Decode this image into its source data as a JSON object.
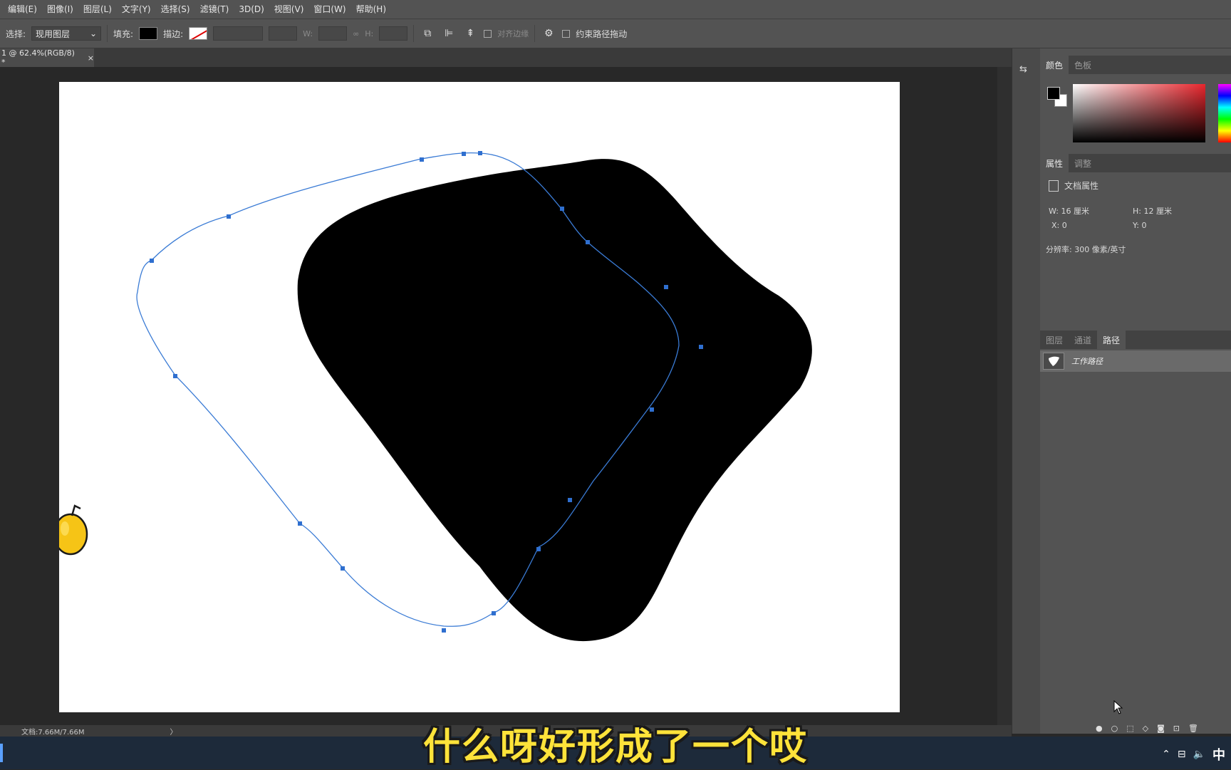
{
  "menubar": {
    "items": [
      "编辑(E)",
      "图像(I)",
      "图层(L)",
      "文字(Y)",
      "选择(S)",
      "滤镜(T)",
      "3D(D)",
      "视图(V)",
      "窗口(W)",
      "帮助(H)"
    ]
  },
  "options": {
    "select_label": "选择:",
    "select_value": "现用图层",
    "fill_label": "填充:",
    "stroke_label": "描边:",
    "w_label": "W:",
    "h_label": "H:",
    "align_edges_label": "对齐边缘",
    "constrain_label": "约束路径拖动"
  },
  "document": {
    "tab_title": "1 @ 62.4%(RGB/8) *",
    "close_glyph": "×"
  },
  "color_panel": {
    "tabs": [
      "颜色",
      "色板"
    ],
    "foreground": "#000000",
    "background": "#ffffff"
  },
  "properties": {
    "tabs": [
      "属性",
      "调整"
    ],
    "section": "文档属性",
    "w_label": "W:",
    "w_value": "16 厘米",
    "h_label": "H:",
    "h_value": "12 厘米",
    "x_label": "X:",
    "x_value": "0",
    "y_label": "Y:",
    "y_value": "0",
    "resolution": "分辨率: 300 像素/英寸"
  },
  "layers": {
    "tabs": [
      "图层",
      "通道",
      "路径"
    ],
    "path_name": "工作路径"
  },
  "status": {
    "doc_size": "文档:7.66M/7.66M",
    "arrow": "〉"
  },
  "subtitle": "什么呀好形成了一个哎",
  "taskbar": {
    "ime": "中"
  },
  "colors": {
    "path_stroke": "#3a7bd5",
    "anchor": "#2f6fcf",
    "shape_fill": "#000000"
  }
}
